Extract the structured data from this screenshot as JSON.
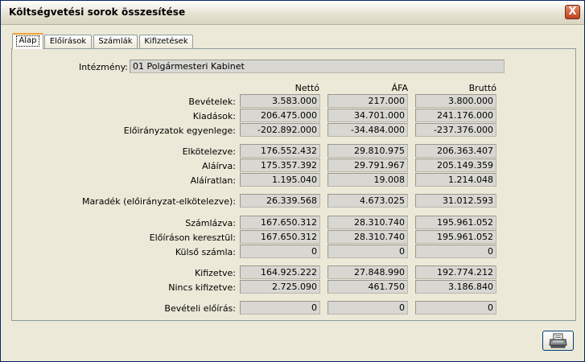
{
  "window": {
    "title": "Költségvetési sorok összesítése",
    "close_label": "X"
  },
  "tabs": [
    {
      "label": "Alap",
      "active": true
    },
    {
      "label": "Előírások",
      "active": false
    },
    {
      "label": "Számlák",
      "active": false
    },
    {
      "label": "Kifizetések",
      "active": false
    }
  ],
  "institution": {
    "label": "Intézmény:",
    "value": "01  Polgármesteri Kabinet"
  },
  "columns": [
    "Nettó",
    "ÁFA",
    "Bruttó"
  ],
  "rows": [
    {
      "label": "Bevételek:",
      "values": [
        "3.583.000",
        "217.000",
        "3.800.000"
      ]
    },
    {
      "label": "Kiadások:",
      "values": [
        "206.475.000",
        "34.701.000",
        "241.176.000"
      ]
    },
    {
      "label": "Előirányzatok egyenlege:",
      "values": [
        "-202.892.000",
        "-34.484.000",
        "-237.376.000"
      ]
    },
    {
      "label": "Elkötelezve:",
      "values": [
        "176.552.432",
        "29.810.975",
        "206.363.407"
      ]
    },
    {
      "label": "Aláírva:",
      "values": [
        "175.357.392",
        "29.791.967",
        "205.149.359"
      ]
    },
    {
      "label": "Aláíratlan:",
      "values": [
        "1.195.040",
        "19.008",
        "1.214.048"
      ]
    },
    {
      "label": "Maradék (előirányzat-elkötelezve):",
      "values": [
        "26.339.568",
        "4.673.025",
        "31.012.593"
      ]
    },
    {
      "label": "Számlázva:",
      "values": [
        "167.650.312",
        "28.310.740",
        "195.961.052"
      ]
    },
    {
      "label": "Előíráson keresztül:",
      "values": [
        "167.650.312",
        "28.310.740",
        "195.961.052"
      ]
    },
    {
      "label": "Külső számla:",
      "values": [
        "0",
        "0",
        "0"
      ]
    },
    {
      "label": "Kifizetve:",
      "values": [
        "164.925.222",
        "27.848.990",
        "192.774.212"
      ]
    },
    {
      "label": "Nincs kifizetve:",
      "values": [
        "2.725.090",
        "461.750",
        "3.186.840"
      ]
    },
    {
      "label": "Bevételi előírás:",
      "values": [
        "0",
        "0",
        "0"
      ]
    }
  ],
  "footer": {
    "print_icon": "printer-icon"
  }
}
